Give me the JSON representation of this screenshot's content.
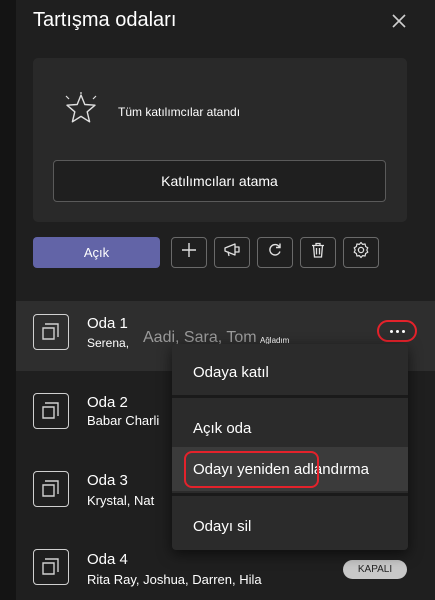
{
  "panel": {
    "title": "Tartışma odaları",
    "close_icon": "close-icon"
  },
  "assign_card": {
    "icon": "star-icon",
    "status_text": "Tüm katılımcılar atandı",
    "assign_button_label": "Katılımcıları atama"
  },
  "toolbar": {
    "open_label": "Açık",
    "icons": [
      "plus-icon",
      "announcement-icon",
      "refresh-icon",
      "delete-icon",
      "settings-icon"
    ]
  },
  "rooms": [
    {
      "name": "Oda 1",
      "members": "Serena,",
      "overlay_names": "Aadi, Sara, Tom",
      "joined_label": "Ağladım"
    },
    {
      "name": "Oda 2",
      "members": "Babar Charli"
    },
    {
      "name": "Oda 3",
      "members": "Krystal, Nat"
    },
    {
      "name": "Oda 4",
      "members": "Rita Ray, Joshua, Darren, Hila",
      "status_badge": "KAPALI"
    }
  ],
  "context_menu": {
    "items": [
      "Odaya katıl",
      "Açık oda",
      "Odayı yeniden adlandırma",
      "Odayı sil"
    ]
  },
  "colors": {
    "background": "#1f1f1f",
    "card": "#292929",
    "accent": "#6264a7",
    "highlight_outline": "#e4222b",
    "menu": "#2b2b2b"
  }
}
